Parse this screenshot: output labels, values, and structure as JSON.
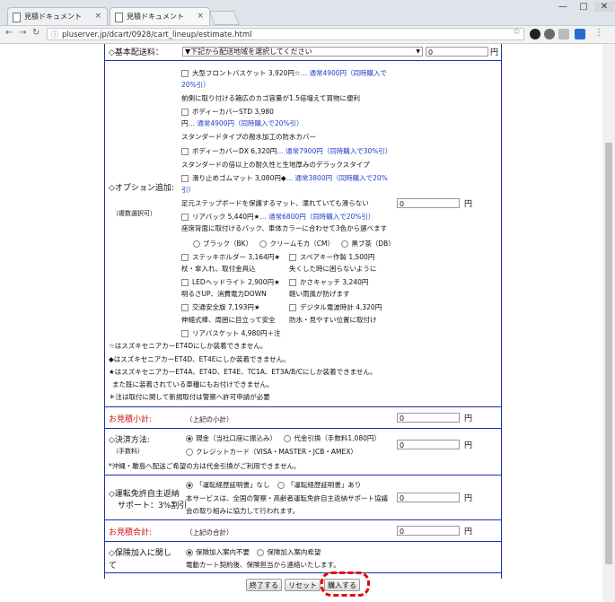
{
  "browser": {
    "tabs": [
      {
        "title": "見積ドキュメント",
        "close": "×"
      },
      {
        "title": "見積ドキュメント",
        "close": "×"
      }
    ],
    "window_buttons": [
      "—",
      "□",
      "✕"
    ],
    "url": "pluserver.jp/dcart/0928/cart_lineup/estimate.html"
  },
  "shipping": {
    "label": "◇基本配送料：",
    "select": "▼下記から配送地域を選択してください",
    "value": "0",
    "unit": "円"
  },
  "options": {
    "label": "◇オプション追加:",
    "sublabel": "（複数選択可）",
    "value": "0",
    "unit": "円",
    "items": [
      {
        "name": "大型フロントバスケット 3,920円☆",
        "price": "… 通常4900円（同時購入で20%引）",
        "desc": "前側に取り付ける箱広のカゴ容量が1.5倍増えて買物に便利"
      },
      {
        "name": "ボディーカバーSTD 3,980円",
        "price": "… 通常4900円（同時購入で20%引）",
        "desc": "スタンダードタイプの撥水加工の防水カバー"
      },
      {
        "name": "ボディーカバーDX 6,320円",
        "price": "… 通常7900円（同時購入で30%引）",
        "desc": "スタンダードの倍以上の耐久性と生地厚みのデラックスタイプ"
      },
      {
        "name": "滑り止めゴムマット 3,080円◆",
        "price": "… 通常3800円（同時購入で20%引）",
        "desc": "足元ステップボードを保護するマット、濡れていても滑らない"
      },
      {
        "name": "リアバック 5,440円★",
        "price": "… 通常6800円（同時購入で20%引）",
        "desc": "座席背面に取付けるバック、車体カラーに合わせて3色から選べます"
      }
    ],
    "colors": [
      "ブラック（BK）",
      "クリームモカ（CM）",
      "黒ブ茶（DB）"
    ],
    "pairs": [
      {
        "left": "ステッキホルダー 3,164円★",
        "left_desc": "杖・傘入れ、取付金具込",
        "right": "スペアキー作製 1,500円",
        "right_desc": "失くした時に困らないように"
      },
      {
        "left": "LEDヘッドライト 2,900円★",
        "left_desc": "明るさUP、消費電力DOWN",
        "right": "かさキャッチ 3,240円",
        "right_desc": "軽い雨風が防げます"
      },
      {
        "left": "交通安全旗 7,193円★",
        "left_desc": "伸縮式棒、周囲に目立って安全",
        "right": "デジタル電波時計 4,320円",
        "right_desc": "防水・見やすい位置に取付け"
      }
    ],
    "last_item": "リアバスケット 4,980円＋注",
    "notes": [
      "☆はスズキセニアカーET4Dにしか装着できません。",
      "◆はスズキセニアカーET4D、ET4Eにしか装着できません。",
      "★はスズキセニアカーET4A、ET4D、ET4E、TC1A、ET3A/B/Cにしか装着できません。",
      "また既に装着されている車種にもお付けできません。",
      "＊注は取付に関して新規取付は警察へ許可申請が必要"
    ]
  },
  "subtotal": {
    "label": "お見積小計:",
    "sub": "（上記の小計）",
    "value": "0",
    "unit": "円"
  },
  "payment": {
    "label": "◇決済方法:",
    "sublabel": "（手数料）",
    "options": [
      "現金（当社口座に振込み）",
      "代金引換（手数料1,080円）",
      "クレジットカード（VISA・MASTER・JCB・AMEX）"
    ],
    "note": "*沖縄・離島へ配送ご希望の方は代金引換がご利用できません。",
    "value": "0",
    "unit": "円"
  },
  "license": {
    "label1": "◇運転免許自主返納",
    "label2": "サポート：3%割引",
    "options": [
      "「運転経歴証明書」なし",
      "「運転経歴証明書」あり"
    ],
    "desc1": "本サービスは、全国の警察・高齢者運転免許自主返納サポート協議",
    "desc2": "会の取り組みに協力して行われます。",
    "value": "0",
    "unit": "円"
  },
  "total": {
    "label": "お見積合計:",
    "sub": "（上記の合計）",
    "value": "0",
    "unit": "円"
  },
  "insurance": {
    "label1": "◇保険加入に関し",
    "label2": "て",
    "options": [
      "保険加入案内不要",
      "保険加入案内希望"
    ],
    "note": "電動カート契約後、保険担当から連絡いたします。"
  },
  "buttons": {
    "end": "終了する",
    "reset": "リセット",
    "buy": "購入する"
  }
}
